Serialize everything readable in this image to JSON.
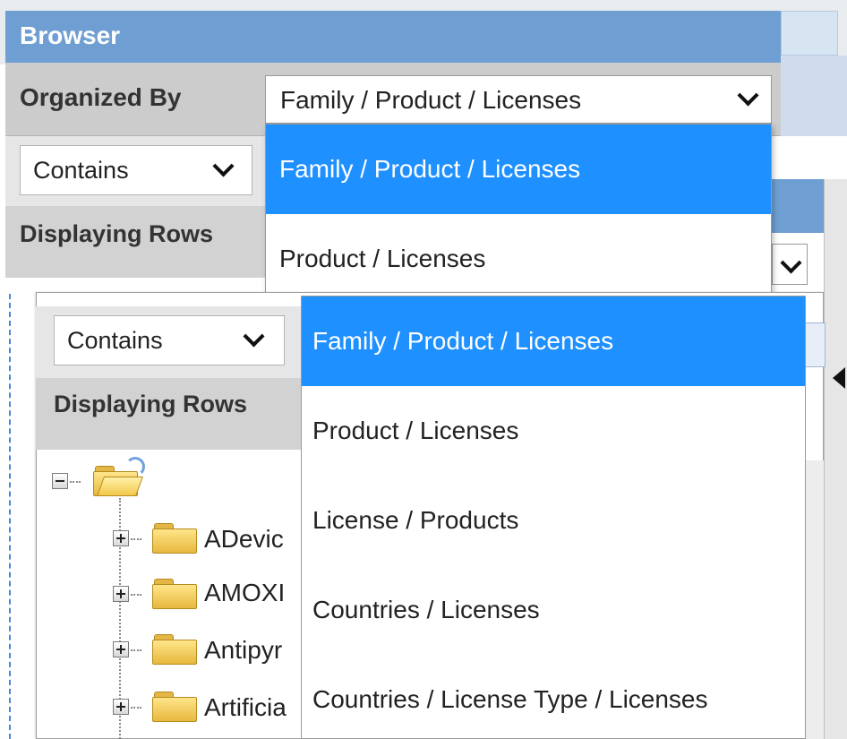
{
  "browser": {
    "title": "Browser",
    "organized_by_label": "Organized By",
    "organized_by_value": "Family / Product / Licenses"
  },
  "filter": {
    "mode_value": "Contains"
  },
  "displaying_rows_label": "Displaying Rows",
  "organize_options": [
    "Family / Product / Licenses",
    "Product / Licenses",
    "License / Products",
    "Countries / Licenses",
    "Countries / License Type / Licenses"
  ],
  "tree": {
    "items": [
      "ADevic",
      "AMOXI",
      "Antipyr",
      "Artificia"
    ]
  },
  "colors": {
    "titlebar": "#6f9fd2",
    "selected_option": "#1e90ff",
    "toolbar_gray": "#cccccc"
  }
}
